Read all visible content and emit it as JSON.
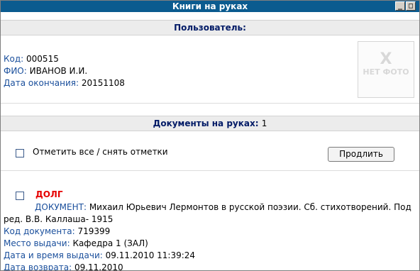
{
  "window": {
    "title": "Книги на руках",
    "minimize_glyph": "_",
    "maximize_glyph": "□"
  },
  "user_section": {
    "header": "Пользователь:",
    "fields": [
      {
        "label": "Код:",
        "value": "000515"
      },
      {
        "label": "ФИО:",
        "value": "ИВАНОВ И.И."
      },
      {
        "label": "Дата окончания:",
        "value": "20151108"
      }
    ],
    "photo": {
      "mark": "X",
      "text": "НЕТ ФОТО"
    }
  },
  "documents_section": {
    "header": "Документы на руках:",
    "count": "1",
    "select_all_label": "Отметить все / снять отметки",
    "renew_button": "Продлить"
  },
  "documents": [
    {
      "status": "ДОЛГ",
      "doc_label": "ДОКУМЕНТ:",
      "doc_value": "Михаил Юрьевич Лермонтов в русской поэзии. Сб. стихотворений. Под ред. В.В. Каллаша- 1915",
      "fields": [
        {
          "label": "Код документа:",
          "value": "719399"
        },
        {
          "label": "Место выдачи:",
          "value": "Кафедра 1 (ЗАЛ)"
        },
        {
          "label": "Дата и время выдачи:",
          "value": "09.11.2010 11:39:24"
        },
        {
          "label": "Дата возврата:",
          "value": "09.11.2010"
        }
      ]
    }
  ],
  "colors": {
    "titlebar": "#0b5b8f",
    "section_header_bg": "#ececec",
    "section_header_text": "#001a66",
    "label_text": "#1a4f9c",
    "debt_text": "#e60000"
  }
}
